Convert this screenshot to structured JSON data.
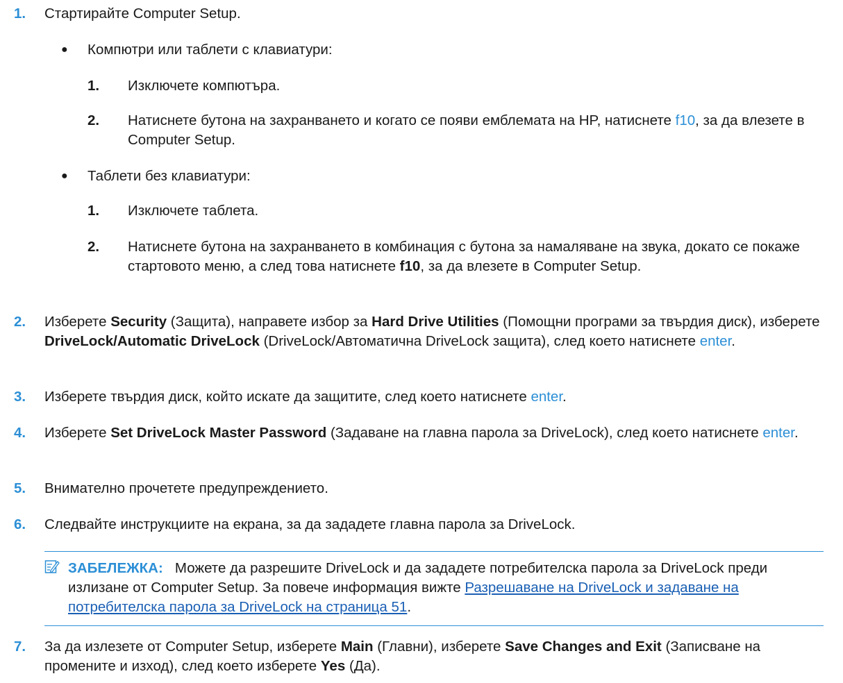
{
  "steps": {
    "s1": {
      "num": "1.",
      "text": "Стартирайте Computer Setup.",
      "b1": {
        "text": "Компютри или таблети с клавиатури:",
        "s1": {
          "num": "1.",
          "text": "Изключете компютъра."
        },
        "s2": {
          "num": "2.",
          "pre": "Натиснете бутона на захранването и когато се появи емблемата на HP, натиснете ",
          "key": "f10",
          "post": ", за да влезете в Computer Setup."
        }
      },
      "b2": {
        "text": "Таблети без клавиатури:",
        "s1": {
          "num": "1.",
          "text": "Изключете таблета."
        },
        "s2": {
          "num": "2.",
          "pre": "Натиснете бутона на захранването в комбинация с бутона за намаляване на звука, докато се покаже стартовото меню, а след това натиснете ",
          "key": "f10",
          "post": ", за да влезете в Computer Setup."
        }
      }
    },
    "s2": {
      "num": "2.",
      "t1": "Изберете ",
      "b1": "Security",
      "t2": " (Защита), направете избор за ",
      "b2": "Hard Drive Utilities",
      "t3": " (Помощни програми за твърдия диск), изберете ",
      "b3": "DriveLock/Automatic DriveLock",
      "t4": " (DriveLock/Автоматична DriveLock защита), след което натиснете ",
      "key": "enter",
      "t5": "."
    },
    "s3": {
      "num": "3.",
      "t1": "Изберете твърдия диск, който искате да защитите, след което натиснете ",
      "key": "enter",
      "t2": "."
    },
    "s4": {
      "num": "4.",
      "t1": "Изберете ",
      "b1": "Set DriveLock Master Password",
      "t2": " (Задаване на главна парола за DriveLock), след което натиснете ",
      "key": "enter",
      "t3": "."
    },
    "s5": {
      "num": "5.",
      "text": "Внимателно прочетете предупреждението."
    },
    "s6": {
      "num": "6.",
      "text": "Следвайте инструкциите на екрана, за да зададете главна парола за DriveLock."
    },
    "note": {
      "label": "ЗАБЕЛЕЖКА:",
      "text": "Можете да разрешите DriveLock и да зададете потребителска парола за DriveLock преди излизане от Computer Setup. За повече информация вижте ",
      "link": "Разрешаване на DriveLock и задаване на потребителска парола за DriveLock на страница 51",
      "tail": "."
    },
    "s7": {
      "num": "7.",
      "t1": "За да излезете от Computer Setup, изберете ",
      "b1": "Main",
      "t2": " (Главни), изберете ",
      "b2": "Save Changes and Exit",
      "t3": " (Записване на промените и изход), след което изберете ",
      "b3": "Yes",
      "t4": " (Да)."
    }
  }
}
